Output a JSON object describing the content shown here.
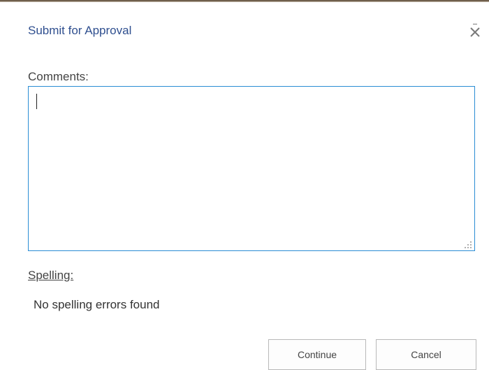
{
  "dialog": {
    "title": "Submit for Approval",
    "close_icon": "close-icon"
  },
  "comments": {
    "label": "Comments:",
    "value": ""
  },
  "spelling": {
    "label": "Spelling:",
    "status": "No spelling errors found"
  },
  "buttons": {
    "continue_label": "Continue",
    "cancel_label": "Cancel"
  },
  "colors": {
    "title_text": "#2f4f8f",
    "field_border_focus": "#2a8dd4",
    "label_text": "#444444",
    "button_border": "#b8b8b8"
  }
}
